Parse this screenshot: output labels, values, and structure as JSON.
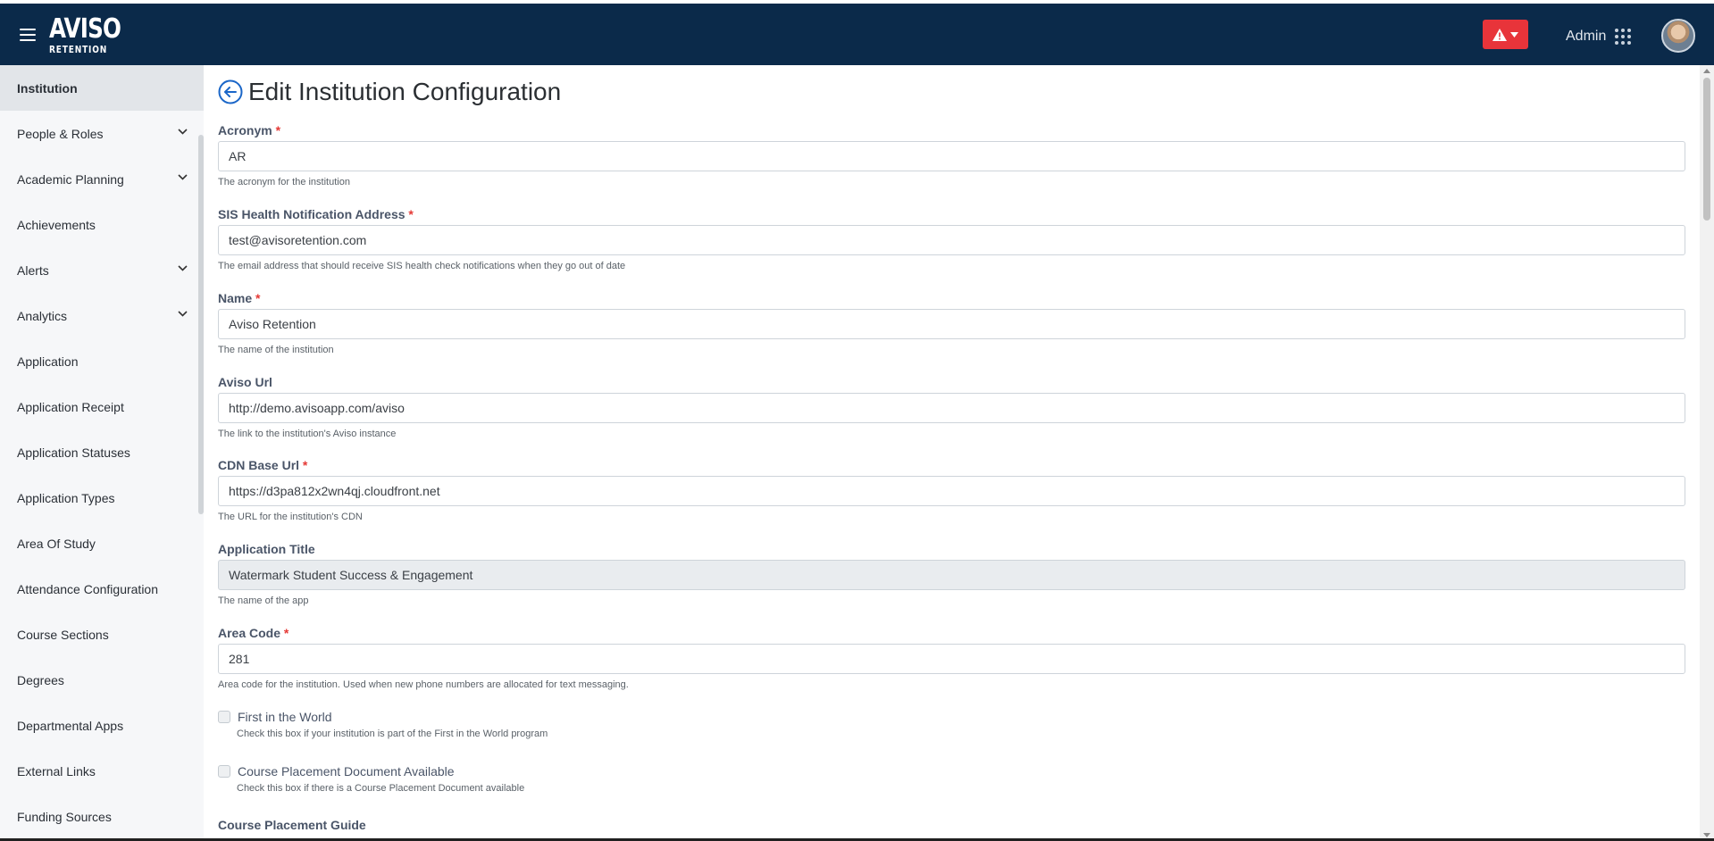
{
  "header": {
    "logo_top": "AVISO",
    "logo_bottom": "RETENTION",
    "user_label": "Admin",
    "accent_color": "#0b2a4a",
    "alert_color": "#e8343a"
  },
  "sidebar": {
    "items": [
      {
        "label": "Institution",
        "expandable": false,
        "active": true
      },
      {
        "label": "People & Roles",
        "expandable": true
      },
      {
        "label": "Academic Planning",
        "expandable": true
      },
      {
        "label": "Achievements",
        "expandable": false
      },
      {
        "label": "Alerts",
        "expandable": true
      },
      {
        "label": "Analytics",
        "expandable": true
      },
      {
        "label": "Application",
        "expandable": false
      },
      {
        "label": "Application Receipt",
        "expandable": false
      },
      {
        "label": "Application Statuses",
        "expandable": false
      },
      {
        "label": "Application Types",
        "expandable": false
      },
      {
        "label": "Area Of Study",
        "expandable": false
      },
      {
        "label": "Attendance Configuration",
        "expandable": false
      },
      {
        "label": "Course Sections",
        "expandable": false
      },
      {
        "label": "Degrees",
        "expandable": false
      },
      {
        "label": "Departmental Apps",
        "expandable": false
      },
      {
        "label": "External Links",
        "expandable": false
      },
      {
        "label": "Funding Sources",
        "expandable": false
      }
    ]
  },
  "main": {
    "title": "Edit Institution Configuration",
    "fields": {
      "acronym": {
        "label": "Acronym",
        "required": "*",
        "value": "AR",
        "help": "The acronym for the institution"
      },
      "sis": {
        "label": "SIS Health Notification Address",
        "required": "*",
        "value": "test@avisoretention.com",
        "help": "The email address that should receive SIS health check notifications when they go out of date"
      },
      "name": {
        "label": "Name",
        "required": "*",
        "value": "Aviso Retention",
        "help": "The name of the institution"
      },
      "aviso_url": {
        "label": "Aviso Url",
        "value": "http://demo.avisoapp.com/aviso",
        "help": "The link to the institution's Aviso instance"
      },
      "cdn": {
        "label": "CDN Base Url",
        "required": "*",
        "value": "https://d3pa812x2wn4qj.cloudfront.net",
        "help": "The URL for the institution's CDN"
      },
      "app_title": {
        "label": "Application Title",
        "value": "Watermark Student Success & Engagement",
        "help": "The name of the app"
      },
      "area_code": {
        "label": "Area Code",
        "required": "*",
        "value": "281",
        "help": "Area code for the institution. Used when new phone numbers are allocated for text messaging."
      }
    },
    "checkboxes": {
      "first_world": {
        "label": "First in the World",
        "help": "Check this box if your institution is part of the First in the World program",
        "checked": false
      },
      "course_doc": {
        "label": "Course Placement Document Available",
        "help": "Check this box if there is a Course Placement Document available",
        "checked": false
      }
    },
    "course_guide_label": "Course Placement Guide"
  }
}
